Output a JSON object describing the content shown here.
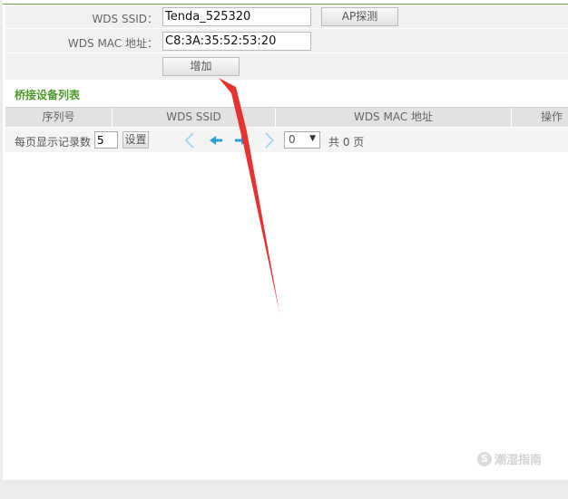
{
  "form": {
    "ssid_label": "WDS SSID：",
    "ssid_value": "Tenda_525320",
    "ap_scan_button": "AP探测",
    "mac_label": "WDS MAC 地址：",
    "mac_value": "C8:3A:35:52:53:20",
    "add_button": "增加"
  },
  "bridge_list": {
    "title": "桥接设备列表",
    "columns": [
      "序列号",
      "WDS SSID",
      "WDS MAC 地址",
      "操作"
    ]
  },
  "pager": {
    "per_page_label": "每页显示记录数",
    "per_page_value": "5",
    "set_button": "设置",
    "page_value": "0",
    "total_text": "共 0 页"
  },
  "watermark": {
    "icon_letter": "S",
    "text": "潮湿指南"
  },
  "colors": {
    "accent_green": "#4e9a2a",
    "arrow_red": "#e8322f",
    "nav_blue": "#2a9fd6"
  },
  "icons": {
    "first_page": "first-page-icon",
    "prev_page": "prev-page-icon",
    "next_page": "next-page-icon",
    "last_page": "last-page-icon"
  }
}
